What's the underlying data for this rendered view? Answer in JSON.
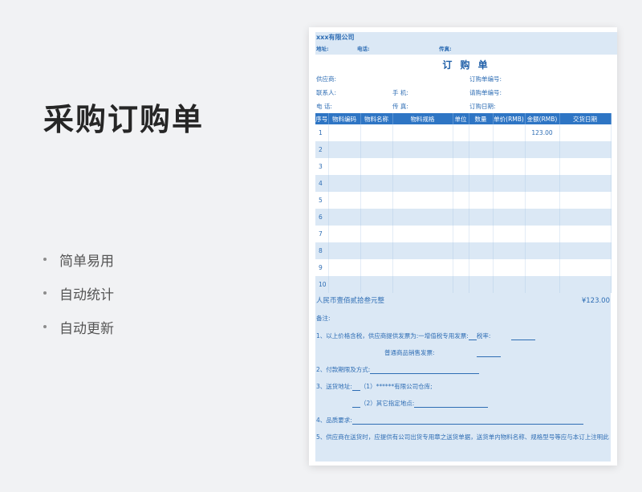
{
  "title": "采购订购单",
  "features": [
    "简单易用",
    "自动统计",
    "自动更新"
  ],
  "form": {
    "company": "xxx有限公司",
    "address_label": "地址:",
    "phone_label": "电话:",
    "fax_label": "传真:",
    "order_title": "订 购 单",
    "supplier_label": "供应商:",
    "po_number_label": "订购单编号:",
    "contact_label": "联系人:",
    "mobile_label": "手  机:",
    "request_number_label": "请购单编号:",
    "tel_label": "电  话:",
    "fax2_label": "传  真:",
    "order_date_label": "订购日期:",
    "columns": [
      "序号",
      "物料编码",
      "物料名称",
      "物料规格",
      "单位",
      "数量",
      "单价(RMB)",
      "金额(RMB)",
      "交货日期"
    ],
    "rows": [
      {
        "idx": "1",
        "amount": "123.00"
      },
      {
        "idx": "2",
        "amount": ""
      },
      {
        "idx": "3",
        "amount": ""
      },
      {
        "idx": "4",
        "amount": ""
      },
      {
        "idx": "5",
        "amount": ""
      },
      {
        "idx": "6",
        "amount": ""
      },
      {
        "idx": "7",
        "amount": ""
      },
      {
        "idx": "8",
        "amount": ""
      },
      {
        "idx": "9",
        "amount": ""
      },
      {
        "idx": "10",
        "amount": ""
      }
    ],
    "total_words": "人民币壹佰贰拾叁元整",
    "total_value": "¥123.00",
    "notes": {
      "heading": "备注:",
      "n1": "1、以上价格含税，供应商提供发票为:一增值税专用发票:",
      "n1_rate": "税率:",
      "n1b": "普通商品销售发票:",
      "n2": "2、付款期限及方式:",
      "n3": "3、送货地址:",
      "n3a": "（1）******有限公司仓库;",
      "n3b": "（2）其它指定地点:",
      "n4": "4、品质要求:",
      "n5": "5、供应商在送货时，应提供有公司出货专用章之送货单据，送货单内物料名称、规格型号等应与本订上注明此"
    }
  }
}
